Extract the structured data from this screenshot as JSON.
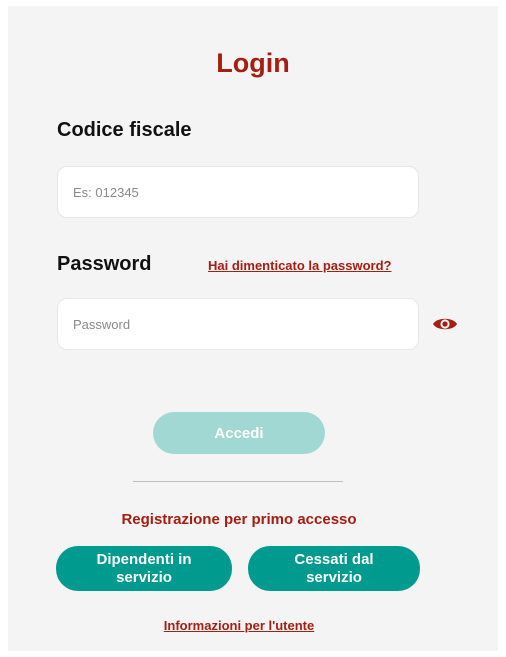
{
  "login": {
    "title": "Login",
    "codice_fiscale": {
      "label": "Codice fiscale",
      "placeholder": "Es: 012345",
      "value": ""
    },
    "password": {
      "label": "Password",
      "placeholder": "Password",
      "value": "",
      "forgot_link": "Hai dimenticato la password?",
      "toggle_icon": "eye-icon"
    },
    "submit_label": "Accedi",
    "registration": {
      "heading": "Registrazione per primo accesso",
      "buttons": [
        {
          "line1": "Dipendenti in",
          "line2": "servizio"
        },
        {
          "line1": "Cessati dal",
          "line2": "servizio"
        }
      ]
    },
    "info_link": "Informazioni per l'utente"
  },
  "colors": {
    "brand_red": "#a61e12",
    "teal": "#009b8e",
    "teal_disabled": "#a2d8d3",
    "panel_bg": "#f4f4f4"
  }
}
